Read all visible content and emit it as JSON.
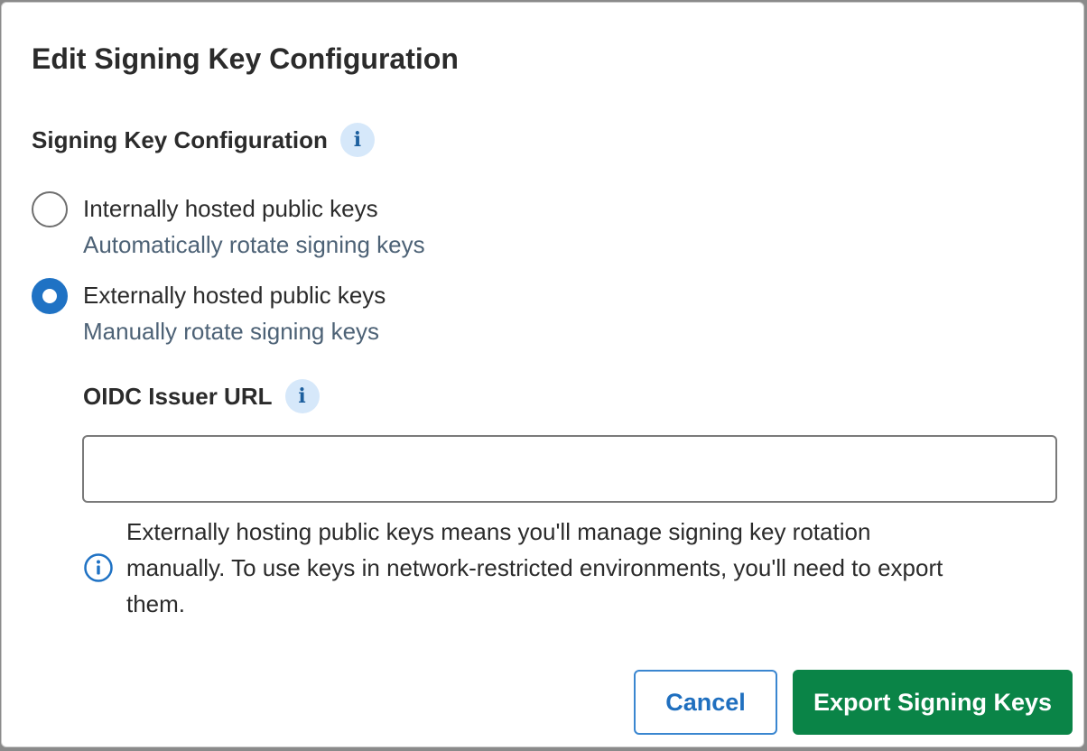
{
  "dialog": {
    "title": "Edit Signing Key Configuration"
  },
  "section": {
    "label": "Signing Key Configuration",
    "info_icon": "info-icon"
  },
  "options": [
    {
      "title": "Internally hosted public keys",
      "description": "Automatically rotate signing keys",
      "selected": false
    },
    {
      "title": "Externally hosted public keys",
      "description": "Manually rotate signing keys",
      "selected": true
    }
  ],
  "oidc": {
    "label": "OIDC Issuer URL",
    "value": "",
    "info_icon": "info-icon"
  },
  "help": {
    "icon": "info-circle-icon",
    "text": "Externally hosting public keys means you'll manage signing key rotation manually. To use keys in network-restricted environments, you'll need to export them."
  },
  "buttons": {
    "cancel_label": "Cancel",
    "export_label": "Export Signing Keys"
  },
  "colors": {
    "primary_blue": "#1f72c4",
    "export_green": "#0a8447",
    "info_badge_bg": "#d6e8fa",
    "description_text": "#4d6276"
  }
}
